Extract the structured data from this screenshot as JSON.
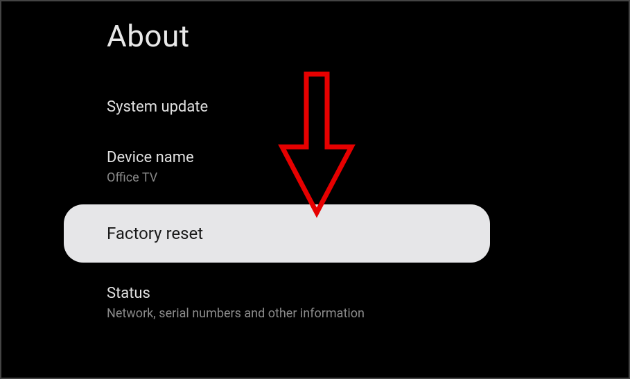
{
  "page": {
    "title": "About"
  },
  "menu": {
    "system_update": {
      "label": "System update"
    },
    "device_name": {
      "label": "Device name",
      "value": "Office TV"
    },
    "factory_reset": {
      "label": "Factory reset"
    },
    "status": {
      "label": "Status",
      "sublabel": "Network, serial numbers and other information"
    }
  },
  "annotation": {
    "arrow_color": "#e60000"
  }
}
